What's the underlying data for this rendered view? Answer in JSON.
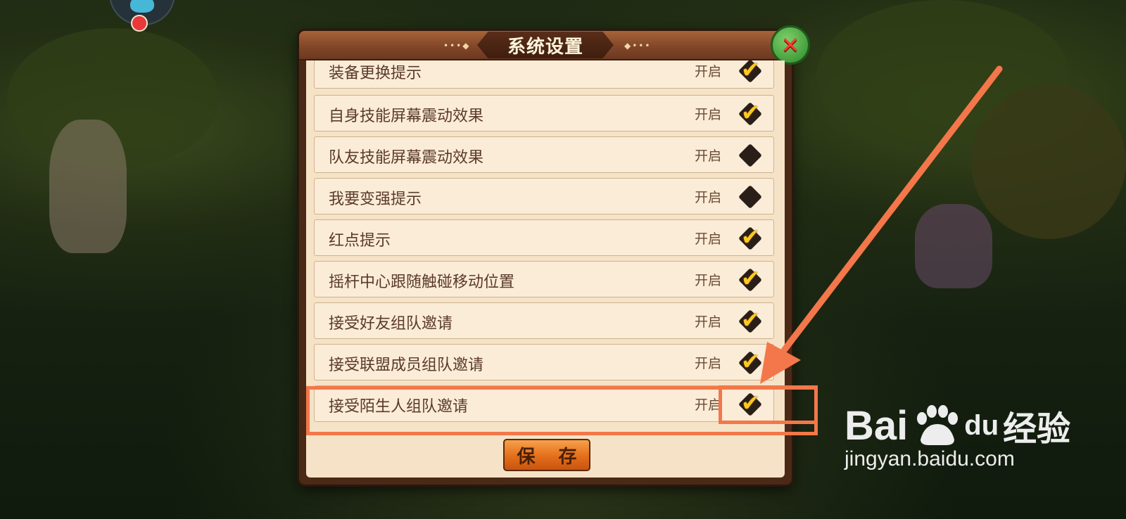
{
  "dialog": {
    "title": "系统设置",
    "save_label": "保 存",
    "status_label": "开启"
  },
  "settings": [
    {
      "label": "装备更换提示",
      "enabled": true
    },
    {
      "label": "自身技能屏幕震动效果",
      "enabled": true
    },
    {
      "label": "队友技能屏幕震动效果",
      "enabled": false
    },
    {
      "label": "我要变强提示",
      "enabled": false
    },
    {
      "label": "红点提示",
      "enabled": true
    },
    {
      "label": "摇杆中心跟随触碰移动位置",
      "enabled": true
    },
    {
      "label": "接受好友组队邀请",
      "enabled": true
    },
    {
      "label": "接受联盟成员组队邀请",
      "enabled": true
    },
    {
      "label": "接受陌生人组队邀请",
      "enabled": true
    }
  ],
  "colors": {
    "accent_annotation": "#f3774a",
    "checkbox_tick": "#ffc821",
    "panel_bg": "#f6e3c7"
  },
  "watermark": {
    "logo_left": "Bai",
    "logo_mid": "du",
    "logo_right": "经验",
    "url": "jingyan.baidu.com"
  }
}
